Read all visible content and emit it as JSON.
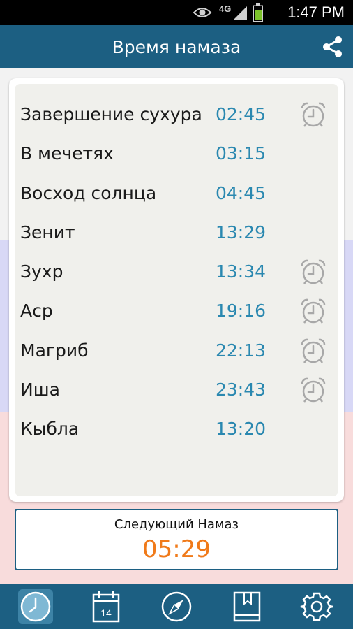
{
  "status_bar": {
    "network": "4G",
    "time": "1:47 PM"
  },
  "header": {
    "title": "Время намаза",
    "share_icon": "share-icon"
  },
  "prayers": [
    {
      "name": "Завершение сухура",
      "time": "02:45",
      "alarm": true
    },
    {
      "name": "В мечетях",
      "time": "03:15",
      "alarm": false
    },
    {
      "name": "Восход солнца",
      "time": "04:45",
      "alarm": false
    },
    {
      "name": "Зенит",
      "time": "13:29",
      "alarm": false
    },
    {
      "name": "Зухр",
      "time": "13:34",
      "alarm": true
    },
    {
      "name": "Аср",
      "time": "19:16",
      "alarm": true
    },
    {
      "name": "Магриб",
      "time": "22:13",
      "alarm": true
    },
    {
      "name": "Иша",
      "time": "23:43",
      "alarm": true
    },
    {
      "name": "Кыбла",
      "time": "13:20",
      "alarm": false
    }
  ],
  "next_prayer": {
    "label": "Следующий Намаз",
    "countdown": "05:29"
  },
  "bottom_nav": {
    "items": [
      {
        "icon": "clock-icon",
        "active": true
      },
      {
        "icon": "calendar-icon",
        "day": "14",
        "active": false
      },
      {
        "icon": "compass-icon",
        "active": false
      },
      {
        "icon": "book-icon",
        "active": false
      },
      {
        "icon": "gear-icon",
        "active": false
      }
    ]
  },
  "colors": {
    "primary": "#1c5f82",
    "time_text": "#2a88b0",
    "countdown": "#f07a1a",
    "alarm_icon": "#a8a8a8"
  }
}
